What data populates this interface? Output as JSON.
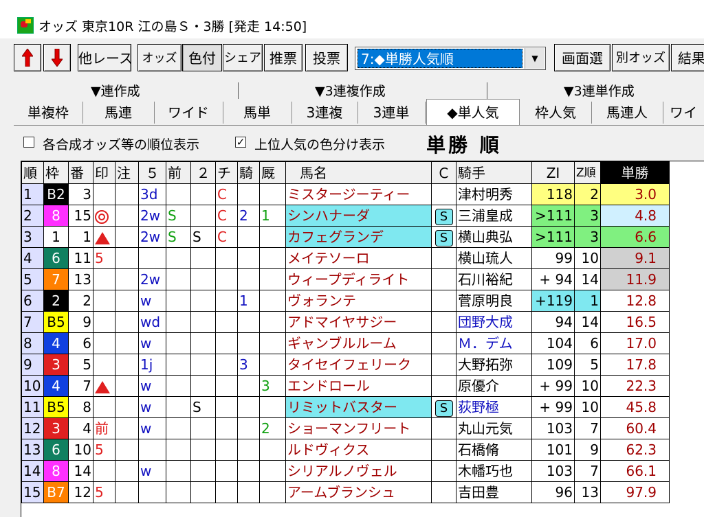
{
  "window": {
    "title": "オッズ 東京10R 江の島Ｓ・3勝 [発走 14:50]"
  },
  "toolbar": {
    "buttons": [
      "他レース",
      "オッズ",
      "色付",
      "シェア",
      "推票",
      "投票"
    ],
    "combo_value": "7:◆単勝人気順",
    "right_buttons": [
      "画面選",
      "別オッズ",
      "結果"
    ]
  },
  "tab_groups": [
    "▼連作成",
    "▼3連複作成",
    "▼3連単作成"
  ],
  "tabs": [
    "単複枠",
    "馬連",
    "ワイド",
    "馬単",
    "3連複",
    "3連単",
    "◆単人気",
    "枠人気",
    "馬連人",
    "ワイ"
  ],
  "options": {
    "opt1": "各合成オッズ等の順位表示",
    "opt2": "上位人気の色分け表示",
    "opt2_checked_mark": "✓"
  },
  "view_title": "単勝 順",
  "columns": [
    "順",
    "枠",
    "番",
    "印",
    "注",
    "５",
    "前",
    "２",
    "チ",
    "騎",
    "厩",
    "馬名",
    "Ｃ",
    "騎手",
    "ZI",
    "Z順",
    "単勝"
  ],
  "colors": {
    "rank_bg": "#dde0ff",
    "cyan": "#7fe8f0",
    "yellow": "#ffff80",
    "green": "#80f080",
    "gray": "#d0d0d0"
  },
  "rows": [
    {
      "rank": "1",
      "waku": "B2",
      "ban": "3",
      "mark": "",
      "chu": "",
      "c5": "3d",
      "mae": "",
      "c2": "",
      "chi": "C",
      "ki": "",
      "kyu": "",
      "name": "ミスタージーティー",
      "c": "",
      "jockey": "津村明秀",
      "zi": "118",
      "zr": "2",
      "odds": "3.0"
    },
    {
      "rank": "2",
      "waku": "8",
      "ban": "15",
      "mark": "◎",
      "chu": "",
      "c5": "2w",
      "mae": "S",
      "c2": "",
      "chi": "C",
      "ki": "2",
      "kyu": "1",
      "name": "シンハナーダ",
      "c": "S",
      "jockey": "三浦皇成",
      "zi": ">111",
      "zr": "3",
      "odds": "4.8"
    },
    {
      "rank": "3",
      "waku": "1",
      "ban": "1",
      "mark": "▲",
      "chu": "",
      "c5": "2w",
      "mae": "S",
      "c2": "S",
      "chi": "C",
      "ki": "",
      "kyu": "",
      "name": "カフェグランデ",
      "c": "S",
      "jockey": "横山典弘",
      "zi": ">111",
      "zr": "3",
      "odds": "6.6"
    },
    {
      "rank": "4",
      "waku": "6",
      "ban": "11",
      "mark": "5",
      "chu": "",
      "c5": "",
      "mae": "",
      "c2": "",
      "chi": "",
      "ki": "",
      "kyu": "",
      "name": "メイテソーロ",
      "c": "",
      "jockey": "横山琉人",
      "zi": "99",
      "zr": "10",
      "odds": "9.1"
    },
    {
      "rank": "5",
      "waku": "7",
      "ban": "13",
      "mark": "",
      "chu": "",
      "c5": "2w",
      "mae": "",
      "c2": "",
      "chi": "",
      "ki": "",
      "kyu": "",
      "name": "ウィープディライト",
      "c": "",
      "jockey": "石川裕紀",
      "zi": "+ 94",
      "zr": "14",
      "odds": "11.9"
    },
    {
      "rank": "6",
      "waku": "2",
      "ban": "2",
      "mark": "",
      "chu": "",
      "c5": "w",
      "mae": "",
      "c2": "",
      "chi": "",
      "ki": "1",
      "kyu": "",
      "name": "ヴォランテ",
      "c": "",
      "jockey": "菅原明良",
      "zi": "+119",
      "zr": "1",
      "odds": "12.8"
    },
    {
      "rank": "7",
      "waku": "B5",
      "ban": "9",
      "mark": "",
      "chu": "",
      "c5": "wd",
      "mae": "",
      "c2": "",
      "chi": "",
      "ki": "",
      "kyu": "",
      "name": "アドマイヤサジー",
      "c": "",
      "jockey": "団野大成",
      "zi": "94",
      "zr": "14",
      "odds": "16.5"
    },
    {
      "rank": "8",
      "waku": "4",
      "ban": "6",
      "mark": "",
      "chu": "",
      "c5": "w",
      "mae": "",
      "c2": "",
      "chi": "",
      "ki": "",
      "kyu": "",
      "name": "ギャンブルルーム",
      "c": "",
      "jockey": "Ｍ．デム",
      "zi": "104",
      "zr": "6",
      "odds": "17.0"
    },
    {
      "rank": "9",
      "waku": "3",
      "ban": "5",
      "mark": "",
      "chu": "",
      "c5": "1j",
      "mae": "",
      "c2": "",
      "chi": "",
      "ki": "3",
      "kyu": "",
      "name": "タイセイフェリーク",
      "c": "",
      "jockey": "大野拓弥",
      "zi": "109",
      "zr": "5",
      "odds": "17.8"
    },
    {
      "rank": "10",
      "waku": "4",
      "ban": "7",
      "mark": "▲",
      "chu": "",
      "c5": "w",
      "mae": "",
      "c2": "",
      "chi": "",
      "ki": "",
      "kyu": "3",
      "name": "エンドロール",
      "c": "",
      "jockey": "原優介",
      "zi": "+ 99",
      "zr": "10",
      "odds": "22.3"
    },
    {
      "rank": "11",
      "waku": "B5",
      "ban": "8",
      "mark": "",
      "chu": "",
      "c5": "w",
      "mae": "",
      "c2": "S",
      "chi": "",
      "ki": "",
      "kyu": "",
      "name": "リミットバスター",
      "c": "S",
      "jockey": "荻野極",
      "zi": "+ 99",
      "zr": "10",
      "odds": "45.8"
    },
    {
      "rank": "12",
      "waku": "3",
      "ban": "4",
      "mark": "前",
      "chu": "",
      "c5": "w",
      "mae": "",
      "c2": "",
      "chi": "",
      "ki": "",
      "kyu": "2",
      "name": "ショーマンフリート",
      "c": "",
      "jockey": "丸山元気",
      "zi": "103",
      "zr": "7",
      "odds": "60.4"
    },
    {
      "rank": "13",
      "waku": "6",
      "ban": "10",
      "mark": "5",
      "chu": "",
      "c5": "",
      "mae": "",
      "c2": "",
      "chi": "",
      "ki": "",
      "kyu": "",
      "name": "ルドヴィクス",
      "c": "",
      "jockey": "石橋脩",
      "zi": "101",
      "zr": "9",
      "odds": "62.3"
    },
    {
      "rank": "14",
      "waku": "8",
      "ban": "14",
      "mark": "",
      "chu": "",
      "c5": "w",
      "mae": "",
      "c2": "",
      "chi": "",
      "ki": "",
      "kyu": "",
      "name": "シリアルノヴェル",
      "c": "",
      "jockey": "木幡巧也",
      "zi": "103",
      "zr": "7",
      "odds": "66.1"
    },
    {
      "rank": "15",
      "waku": "B7",
      "ban": "12",
      "mark": "5",
      "chu": "",
      "c5": "",
      "mae": "",
      "c2": "",
      "chi": "",
      "ki": "",
      "kyu": "",
      "name": "アームブランシュ",
      "c": "",
      "jockey": "吉田豊",
      "zi": "96",
      "zr": "13",
      "odds": "97.9"
    }
  ]
}
